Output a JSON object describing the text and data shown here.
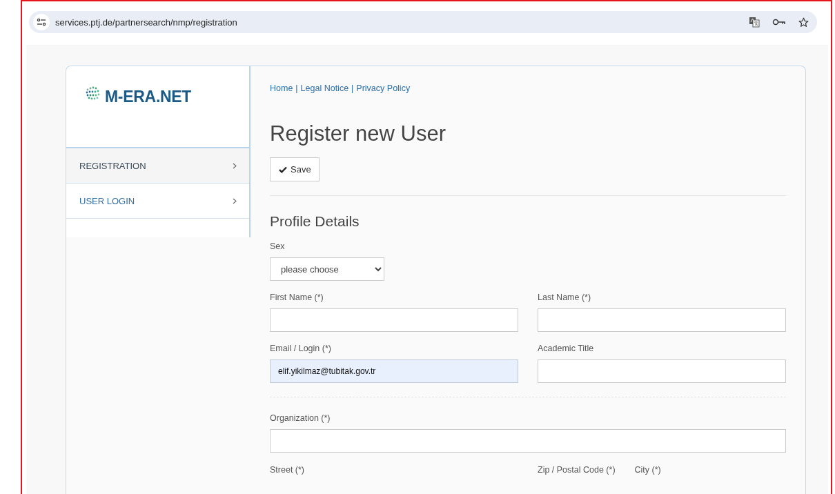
{
  "browser": {
    "url": "services.ptj.de/partnersearch/nmp/registration"
  },
  "sidebar": {
    "logo": "M-ERA.NET",
    "items": [
      {
        "label": "REGISTRATION",
        "selected": true
      },
      {
        "label": "USER LOGIN",
        "selected": false
      }
    ]
  },
  "top_links": {
    "separator": "|",
    "items": [
      "Home",
      "Legal Notice",
      "Privacy Policy"
    ]
  },
  "title": "Register new User",
  "save_button": {
    "label": "Save"
  },
  "section_title": "Profile Details",
  "form_rows": [
    {
      "kind": "fields",
      "fields": [
        {
          "kind": "select",
          "label": "Sex",
          "value": "please choose"
        }
      ]
    },
    {
      "kind": "fields",
      "fields": [
        {
          "kind": "text",
          "label": "First Name (*)",
          "autofilled": false
        },
        {
          "kind": "text",
          "label": "Last Name (*)",
          "autofilled": false
        }
      ]
    },
    {
      "kind": "fields",
      "fields": [
        {
          "kind": "text",
          "label": "Email / Login (*)",
          "value": "elif.yikilmaz@tubitak.gov.tr",
          "autofilled": true
        },
        {
          "kind": "text",
          "label": "Academic Title",
          "autofilled": false
        }
      ]
    },
    {
      "kind": "divider"
    },
    {
      "kind": "fields",
      "fields": [
        {
          "kind": "wide",
          "label": "Organization (*)",
          "autofilled": false
        }
      ]
    },
    {
      "kind": "labels",
      "fields": [
        {
          "kind": "label",
          "label": "Street (*)"
        },
        {
          "kind": "label",
          "label": "Zip / Postal Code (*)"
        },
        {
          "kind": "label",
          "label": "City (*)"
        }
      ]
    }
  ]
}
